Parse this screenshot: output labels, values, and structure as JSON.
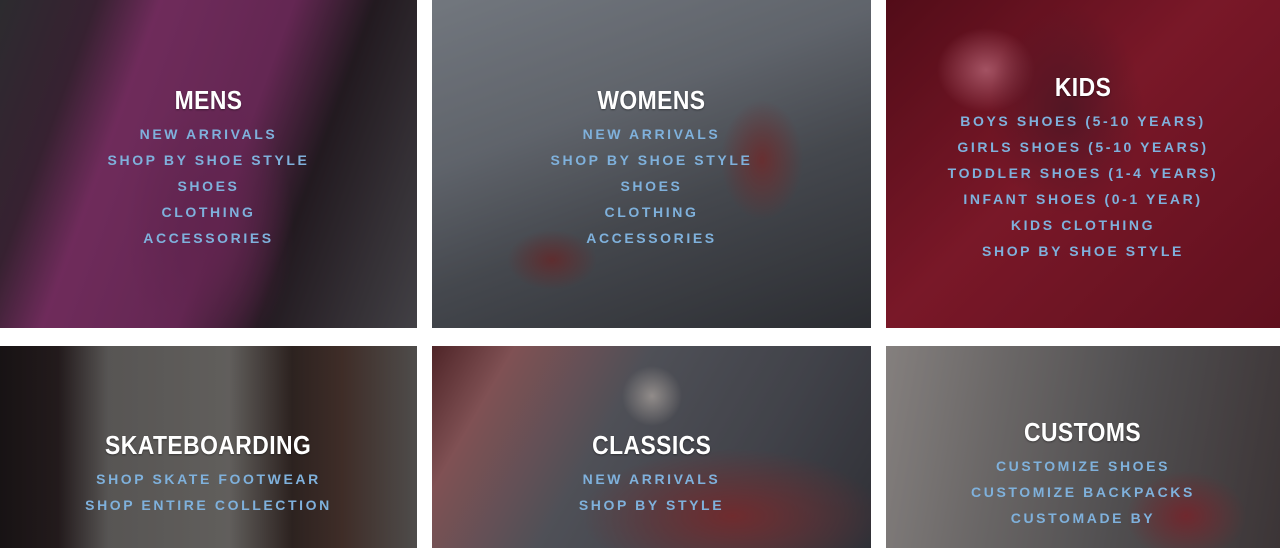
{
  "tiles": [
    {
      "title": "MENS",
      "links": [
        "NEW ARRIVALS",
        "SHOP BY SHOE STYLE",
        "SHOES",
        "CLOTHING",
        "ACCESSORIES"
      ]
    },
    {
      "title": "WOMENS",
      "links": [
        "NEW ARRIVALS",
        "SHOP BY SHOE STYLE",
        "SHOES",
        "CLOTHING",
        "ACCESSORIES"
      ]
    },
    {
      "title": "KIDS",
      "links": [
        "BOYS SHOES (5-10 YEARS)",
        "GIRLS SHOES (5-10 YEARS)",
        "TODDLER SHOES (1-4 YEARS)",
        "INFANT SHOES (0-1 YEAR)",
        "KIDS CLOTHING",
        "SHOP BY SHOE STYLE"
      ]
    },
    {
      "title": "SKATEBOARDING",
      "links": [
        "SHOP SKATE FOOTWEAR",
        "SHOP ENTIRE COLLECTION"
      ]
    },
    {
      "title": "CLASSICS",
      "links": [
        "NEW ARRIVALS",
        "SHOP BY STYLE"
      ]
    },
    {
      "title": "CUSTOMS",
      "links": [
        "CUSTOMIZE SHOES",
        "CUSTOMIZE BACKPACKS",
        "CUSTOMADE BY"
      ]
    }
  ],
  "colors": {
    "title": "#ffffff",
    "link": "#7fb1dc",
    "page_background": "#ffffff"
  }
}
